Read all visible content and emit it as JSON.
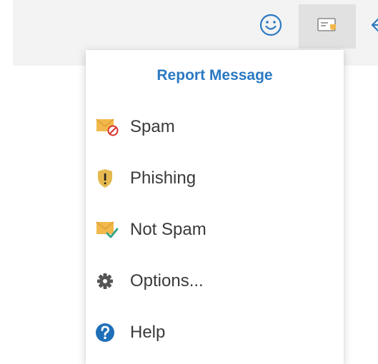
{
  "toolbar": {
    "buttons": [
      {
        "icon": "smiley-icon"
      },
      {
        "icon": "report-message-icon",
        "active": true
      },
      {
        "icon": "back-arrow-icon"
      }
    ]
  },
  "menu": {
    "title": "Report Message",
    "items": [
      {
        "label": "Spam",
        "icon": "spam-envelope-icon"
      },
      {
        "label": "Phishing",
        "icon": "phishing-shield-icon"
      },
      {
        "label": "Not Spam",
        "icon": "not-spam-envelope-icon"
      },
      {
        "label": "Options...",
        "icon": "gear-icon"
      },
      {
        "label": "Help",
        "icon": "help-icon"
      }
    ]
  },
  "colors": {
    "accent": "#2b79c2",
    "envelope": "#f2b84b",
    "shield": "#e5b94f",
    "check": "#3aa68a",
    "forbidden": "#d9342b",
    "gear": "#555555",
    "help": "#1f6fb8"
  }
}
